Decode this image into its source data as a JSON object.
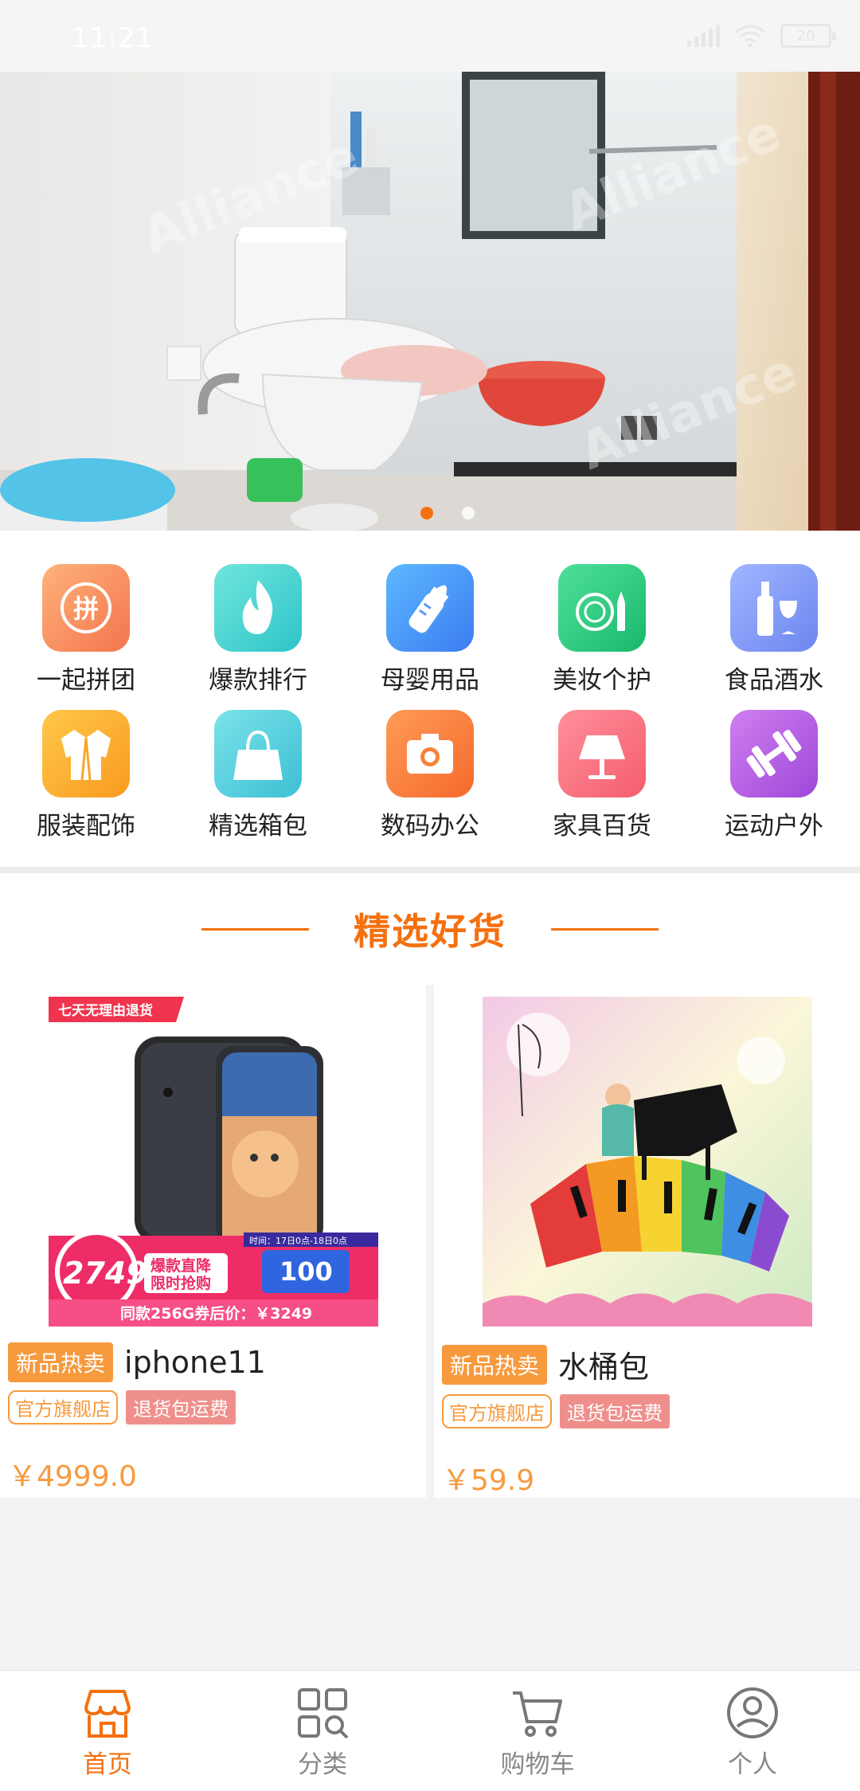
{
  "status_bar": {
    "time": "11:21",
    "battery": "20"
  },
  "banner": {
    "slide_count": 2,
    "active_slide": 1,
    "watermark": "Alliance"
  },
  "categories": [
    {
      "label": "一起拼团",
      "icon": "group-buy-icon",
      "glyph": "拼",
      "color_from": "#ffb37a",
      "color_to": "#f2744d"
    },
    {
      "label": "爆款排行",
      "icon": "flame-icon",
      "color_from": "#6fe6dc",
      "color_to": "#2fc4c9"
    },
    {
      "label": "母婴用品",
      "icon": "baby-bottle-icon",
      "color_from": "#5cb8ff",
      "color_to": "#3d7df2"
    },
    {
      "label": "美妆个护",
      "icon": "makeup-icon",
      "color_from": "#4fe09a",
      "color_to": "#19b86c"
    },
    {
      "label": "食品酒水",
      "icon": "wine-icon",
      "color_from": "#9fb6ff",
      "color_to": "#6d86f0"
    },
    {
      "label": "服装配饰",
      "icon": "jacket-icon",
      "color_from": "#ffc84a",
      "color_to": "#f99a1f"
    },
    {
      "label": "精选箱包",
      "icon": "handbag-icon",
      "color_from": "#7be2e9",
      "color_to": "#3cc0d4"
    },
    {
      "label": "数码办公",
      "icon": "camera-icon",
      "color_from": "#ff9b57",
      "color_to": "#f56a2c"
    },
    {
      "label": "家具百货",
      "icon": "lamp-icon",
      "color_from": "#ff8f9a",
      "color_to": "#f55d6f"
    },
    {
      "label": "运动户外",
      "icon": "dumbbell-icon",
      "color_from": "#cf7ff0",
      "color_to": "#9d48d8"
    }
  ],
  "section": {
    "title": "精选好货"
  },
  "products": [
    {
      "name": "iphone11",
      "hot_tag": "新品热卖",
      "store_tag": "官方旗舰店",
      "service_tag": "退货包运费",
      "price": "￥4999.0",
      "promo": {
        "top_banner": "七天无理由退货",
        "price_badge": "2749",
        "headline_1": "爆款直降",
        "headline_2": "限时抢购",
        "coupon": "100",
        "time": "时间：17日0点-18日0点",
        "footer": "同款256G券后价：￥3249"
      }
    },
    {
      "name": "水桶包",
      "hot_tag": "新品热卖",
      "store_tag": "官方旗舰店",
      "service_tag": "退货包运费",
      "price": "￥59.9"
    }
  ],
  "tabs": [
    {
      "label": "首页",
      "icon": "store-icon",
      "active": true
    },
    {
      "label": "分类",
      "icon": "category-grid-icon",
      "active": false
    },
    {
      "label": "购物车",
      "icon": "cart-icon",
      "active": false
    },
    {
      "label": "个人",
      "icon": "person-icon",
      "active": false
    }
  ],
  "colors": {
    "accent": "#f4700f",
    "price": "#f79a3e",
    "tag_fill": "#ef8f8c"
  }
}
